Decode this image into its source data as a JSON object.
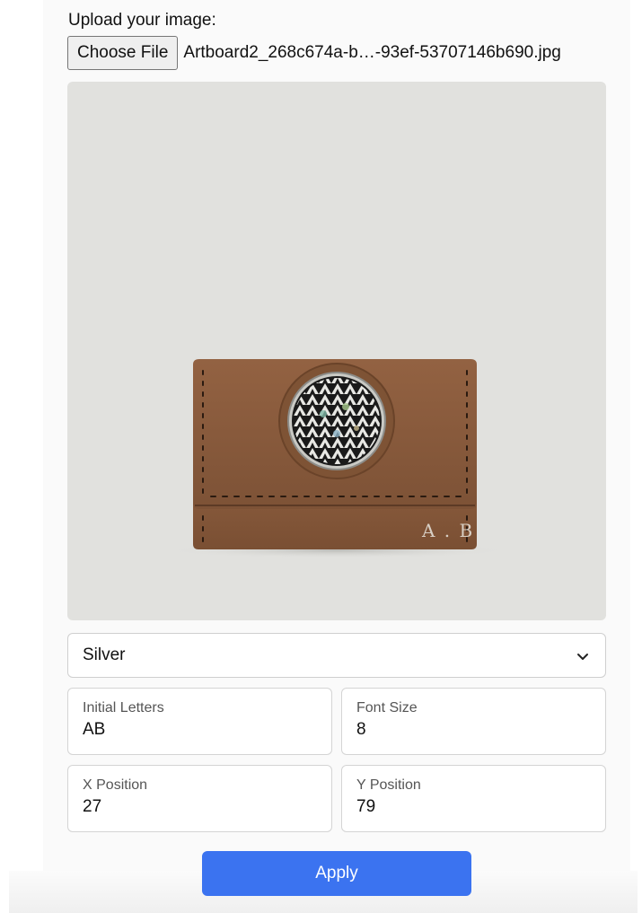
{
  "upload": {
    "label": "Upload your image:",
    "button_label": "Choose File",
    "file_name": "Artboard2_268c674a-b…-93ef-53707146b690.jpg"
  },
  "preview": {
    "engraving_text": "A . B",
    "product_icon": "wallet-image"
  },
  "color_select": {
    "value": "Silver",
    "icon": "chevron-down-icon"
  },
  "fields": {
    "initial_letters": {
      "label": "Initial Letters",
      "value": "AB"
    },
    "font_size": {
      "label": "Font Size",
      "value": "8"
    },
    "x_position": {
      "label": "X Position",
      "value": "27"
    },
    "y_position": {
      "label": "Y Position",
      "value": "79"
    }
  },
  "apply": {
    "label": "Apply"
  },
  "colors": {
    "accent": "#3b73f0",
    "preview_bg": "#e1e1de",
    "wallet_leather": "#8a5a3c"
  }
}
